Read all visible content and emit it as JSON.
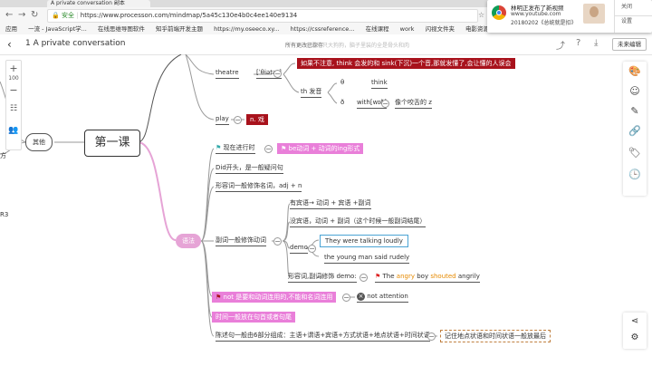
{
  "browser": {
    "tab_title": "A private conversation 副本",
    "security_label": "安全",
    "url": "https://www.processon.com/mindmap/5a45c130e4b0c4ee140e9134",
    "bookmarks": [
      "应用",
      "一流 - JavaScript学...",
      "在线思维导图软件",
      "知乎前端开发主题",
      "https://my.oseeco.xy...",
      "https://cssreference...",
      "在线课程",
      "work",
      "闪视文件夹",
      "电影资源"
    ]
  },
  "notification": {
    "title": "林明正发布了新视频",
    "site": "www.youtube.com",
    "detail": "20180202《总统就是扣》",
    "close_label": "关闭",
    "settings_label": "设置"
  },
  "header": {
    "title": "1 A private conversation",
    "saved": "所有更改已保存",
    "ghost_text": "我是一只大狗狗，脑子里装的全是骨头和肉",
    "edit_label": "未来编辑"
  },
  "left_toolbar": {
    "zoom_value": "100",
    "plus": "+",
    "minus": "−"
  },
  "mindmap": {
    "central": "第一课",
    "other": "其他",
    "left_frag_1": "方",
    "left_frag_2": "R3",
    "theatre": {
      "word": "theatre",
      "ipa": "[ˈθiətər]",
      "note": "如果不注意, think 会发的和 sink(下沉)一个音,那就发懂了,会让懂的人误会",
      "th_label": "th 发音",
      "theta": "θ",
      "theta_word": "think",
      "eth": "ð",
      "eth_word": "with[wɪð]",
      "eth_note": "像个咬舌的 z"
    },
    "play": {
      "word": "play",
      "meaning": "n. 戏"
    },
    "grammar": {
      "label": "语法",
      "progressive": "现在进行时",
      "progressive_note": "be动词 + 动词的ing形式",
      "did_start": "Did开头，是一般疑问句",
      "adj_note": "形容词一般修饰名词，adj + n",
      "adverb_label": "副词一般修饰动词",
      "adv_rule1": "有宾语→ 动词 + 宾语 +副词",
      "adv_rule2": "没宾语，动词 + 副词（这个时候一般副词结尾）",
      "demo_label": "demo",
      "demo1": "They were talking loudly",
      "demo2": "the young man said rudely",
      "adj_adv_label": "形容词,副词修饰 demo:",
      "example_the": "The",
      "example_angry": "angry",
      "example_boy": "boy",
      "example_shouted": "shouted",
      "example_angrily": "angrily",
      "not_rule": "not 是要和动词连用的,不能和名词连用",
      "not_attention": "not attention",
      "time_rule": "时间一般放在句首或者句尾",
      "statement_order": "陈述句一般由6部分组成：主语+谓语+宾语+方式状语+地点状语+时间状语",
      "statement_note": "记住地点状语和时间状语一般放最后"
    }
  },
  "colors": {
    "red_box": "#a8121c",
    "pink_box": "#e97fd9",
    "branch": "#e6a4d6"
  }
}
